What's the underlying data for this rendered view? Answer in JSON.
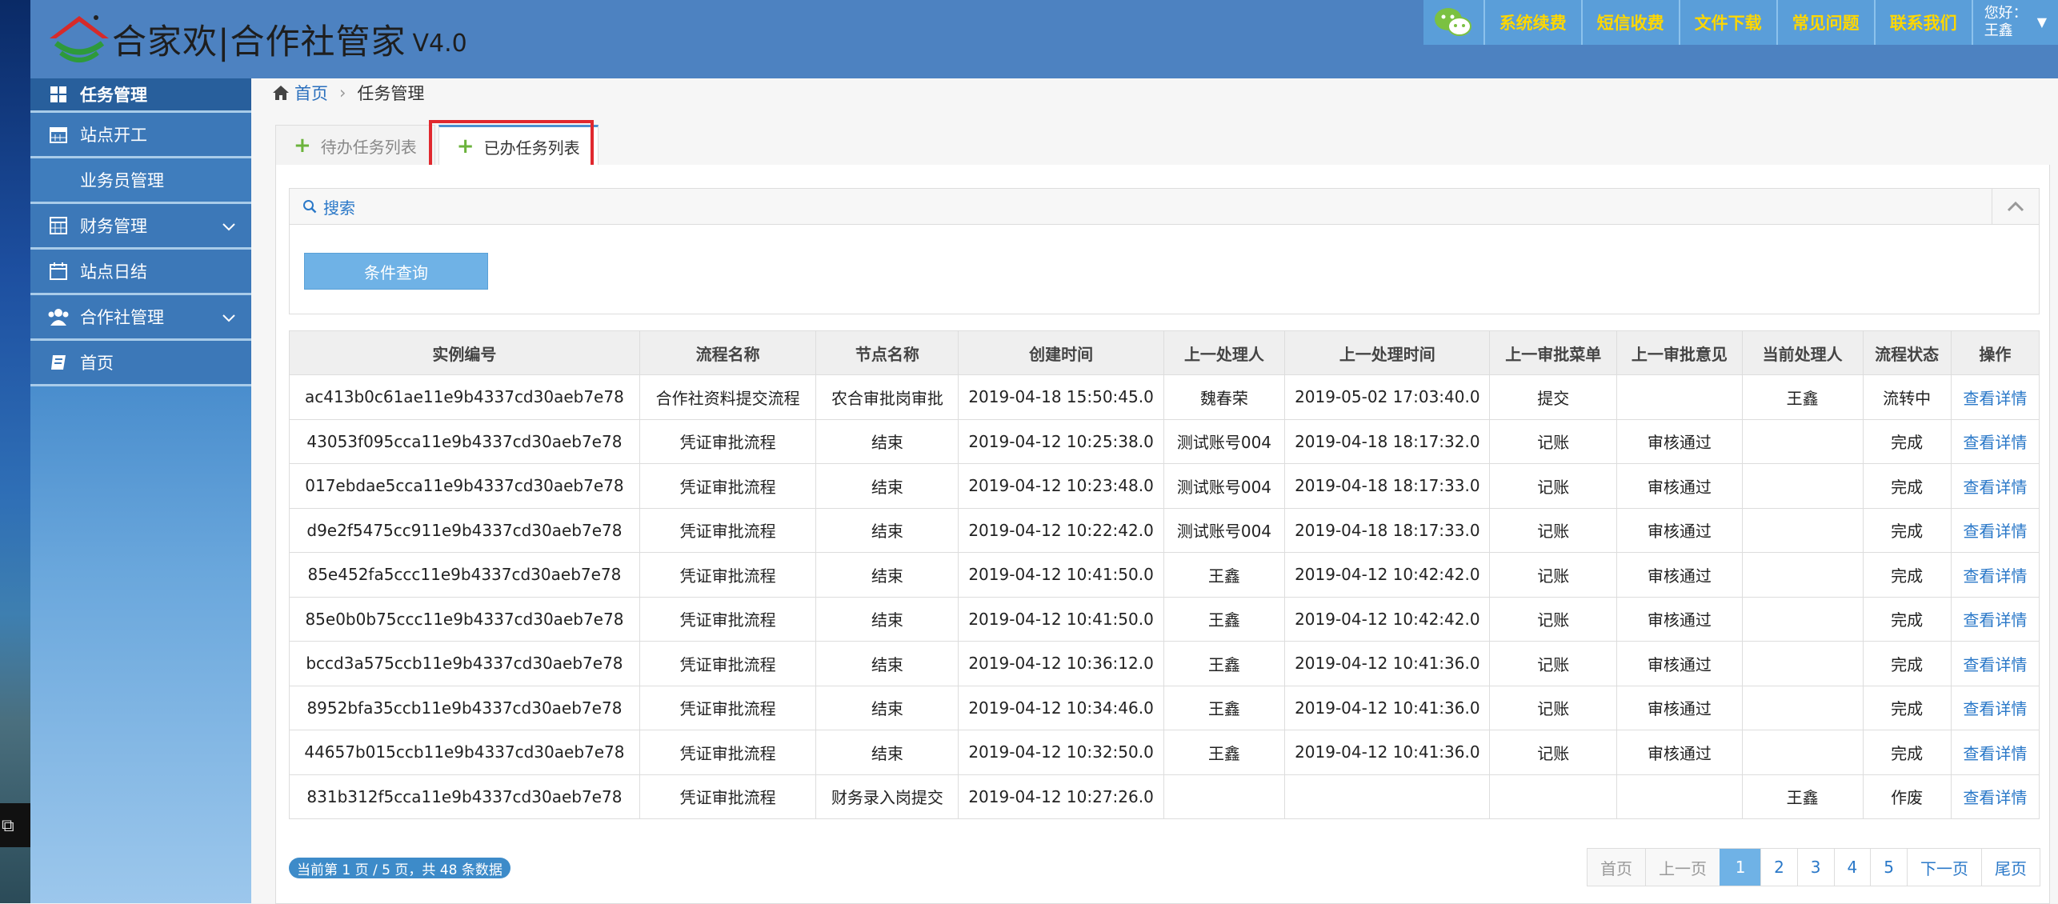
{
  "header": {
    "brand": "合家欢|合作社管家",
    "version": "V4.0",
    "nav": [
      "系统续费",
      "短信收费",
      "文件下载",
      "常见问题",
      "联系我们"
    ],
    "greeting": "您好：",
    "user_name": "王鑫"
  },
  "sidebar": {
    "items": [
      {
        "label": "任务管理",
        "icon": "grid-icon"
      },
      {
        "label": "站点开工",
        "icon": "calendar-icon"
      },
      {
        "label": "业务员管理",
        "icon": ""
      },
      {
        "label": "财务管理",
        "icon": "calculator-icon"
      },
      {
        "label": "站点日结",
        "icon": "calendar-icon"
      },
      {
        "label": "合作社管理",
        "icon": "users-icon"
      },
      {
        "label": "首页",
        "icon": "book-icon"
      }
    ]
  },
  "breadcrumb": {
    "home": "首页",
    "current": "任务管理"
  },
  "tabs": [
    "待办任务列表",
    "已办任务列表"
  ],
  "search": {
    "title": "搜索",
    "button": "条件查询"
  },
  "table": {
    "headers": [
      "实例编号",
      "流程名称",
      "节点名称",
      "创建时间",
      "上一处理人",
      "上一处理时间",
      "上一审批菜单",
      "上一审批意见",
      "当前处理人",
      "流程状态",
      "操作"
    ],
    "rows": [
      [
        "ac413b0c61ae11e9b4337cd30aeb7e78",
        "合作社资料提交流程",
        "农合审批岗审批",
        "2019-04-18 15:50:45.0",
        "魏春荣",
        "2019-05-02 17:03:40.0",
        "提交",
        "",
        "王鑫",
        "流转中",
        "查看详情"
      ],
      [
        "43053f095cca11e9b4337cd30aeb7e78",
        "凭证审批流程",
        "结束",
        "2019-04-12 10:25:38.0",
        "测试账号004",
        "2019-04-18 18:17:32.0",
        "记账",
        "审核通过",
        "",
        "完成",
        "查看详情"
      ],
      [
        "017ebdae5cca11e9b4337cd30aeb7e78",
        "凭证审批流程",
        "结束",
        "2019-04-12 10:23:48.0",
        "测试账号004",
        "2019-04-18 18:17:33.0",
        "记账",
        "审核通过",
        "",
        "完成",
        "查看详情"
      ],
      [
        "d9e2f5475cc911e9b4337cd30aeb7e78",
        "凭证审批流程",
        "结束",
        "2019-04-12 10:22:42.0",
        "测试账号004",
        "2019-04-18 18:17:33.0",
        "记账",
        "审核通过",
        "",
        "完成",
        "查看详情"
      ],
      [
        "85e452fa5ccc11e9b4337cd30aeb7e78",
        "凭证审批流程",
        "结束",
        "2019-04-12 10:41:50.0",
        "王鑫",
        "2019-04-12 10:42:42.0",
        "记账",
        "审核通过",
        "",
        "完成",
        "查看详情"
      ],
      [
        "85e0b0b75ccc11e9b4337cd30aeb7e78",
        "凭证审批流程",
        "结束",
        "2019-04-12 10:41:50.0",
        "王鑫",
        "2019-04-12 10:42:42.0",
        "记账",
        "审核通过",
        "",
        "完成",
        "查看详情"
      ],
      [
        "bccd3a575ccb11e9b4337cd30aeb7e78",
        "凭证审批流程",
        "结束",
        "2019-04-12 10:36:12.0",
        "王鑫",
        "2019-04-12 10:41:36.0",
        "记账",
        "审核通过",
        "",
        "完成",
        "查看详情"
      ],
      [
        "8952bfa35ccb11e9b4337cd30aeb7e78",
        "凭证审批流程",
        "结束",
        "2019-04-12 10:34:46.0",
        "王鑫",
        "2019-04-12 10:41:36.0",
        "记账",
        "审核通过",
        "",
        "完成",
        "查看详情"
      ],
      [
        "44657b015ccb11e9b4337cd30aeb7e78",
        "凭证审批流程",
        "结束",
        "2019-04-12 10:32:50.0",
        "王鑫",
        "2019-04-12 10:41:36.0",
        "记账",
        "审核通过",
        "",
        "完成",
        "查看详情"
      ],
      [
        "831b312f5cca11e9b4337cd30aeb7e78",
        "凭证审批流程",
        "财务录入岗提交",
        "2019-04-12 10:27:26.0",
        "",
        "",
        "",
        "",
        "王鑫",
        "作废",
        "查看详情"
      ]
    ]
  },
  "pagination": {
    "info": "当前第 1 页 / 5 页，共 48 条数据",
    "first": "首页",
    "prev": "上一页",
    "pages": [
      "1",
      "2",
      "3",
      "4",
      "5"
    ],
    "current": "1",
    "next": "下一页",
    "last": "尾页"
  }
}
